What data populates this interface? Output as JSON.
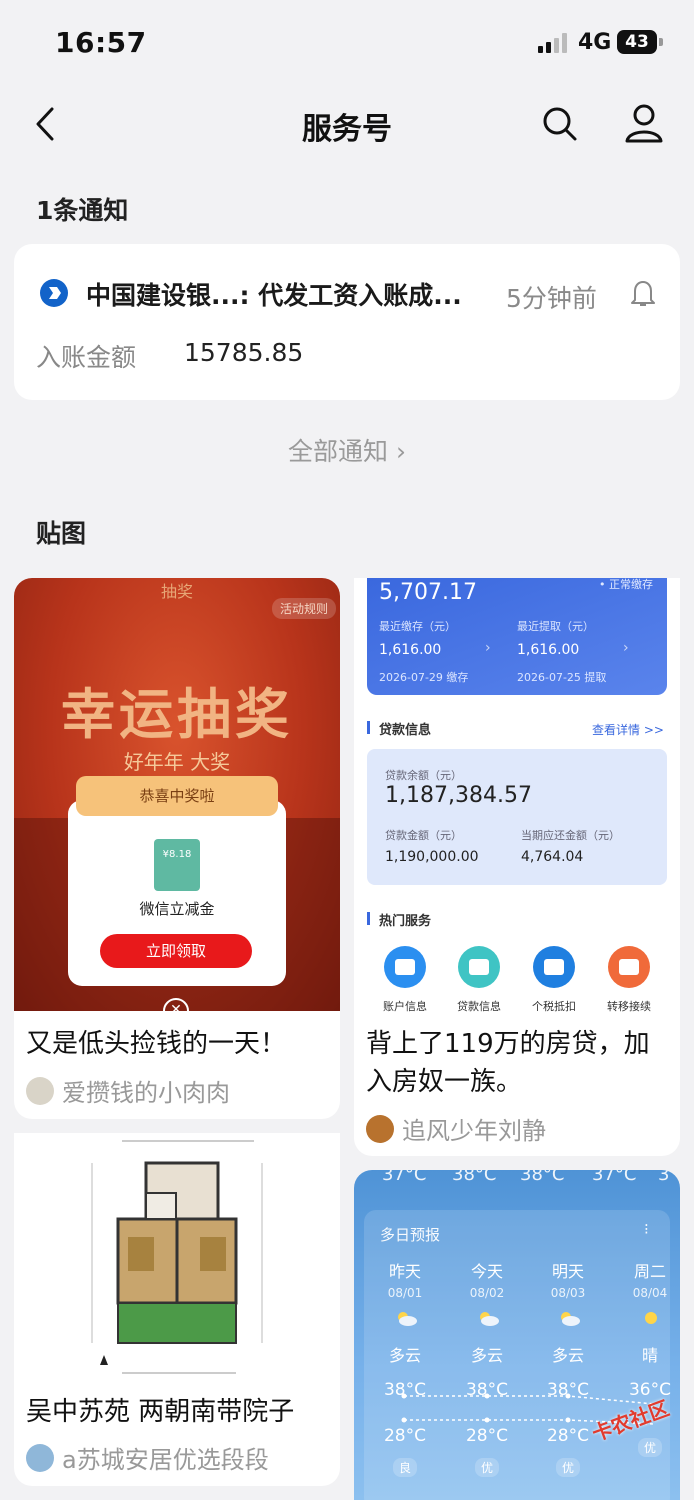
{
  "status_bar": {
    "time": "16:57",
    "network": "4G",
    "battery": "43"
  },
  "nav": {
    "title": "服务号"
  },
  "notices": {
    "heading": "1条通知",
    "item": {
      "sender": "中国建设银...: 代发工资入账成...",
      "time": "5分钟前",
      "amount_label": "入账金额",
      "amount_value": "15785.85"
    },
    "all_link": "全部通知"
  },
  "posts": {
    "heading": "贴图",
    "items": [
      {
        "caption": "又是低头捡钱的一天！",
        "author": "爱攒钱的小肉肉",
        "image": {
          "header": "抽奖",
          "rule": "活动规则",
          "title": "幸运抽奖",
          "subtitle": "好年年    大奖",
          "ribbon": "恭喜中奖啦",
          "ticket": "¥8.18",
          "prize": "微信立减金",
          "button": "立即领取"
        }
      },
      {
        "caption": "背上了119万的房贷，加入房奴一族。",
        "author": "追风少年刘静",
        "image": {
          "balance": "5,707.17",
          "status": "• 正常缴存",
          "recent_deposit_label": "最近缴存（元）",
          "recent_deposit": "1,616.00",
          "deposit_date": "2026-07-29 缴存",
          "recent_withdraw_label": "最近提取（元）",
          "recent_withdraw": "1,616.00",
          "withdraw_date": "2026-07-25 提取",
          "loan_section": "贷款信息",
          "detail_link": "查看详情 >>",
          "loan_balance_label": "贷款余额（元）",
          "loan_balance": "1,187,384.57",
          "loan_amount_label": "贷款金额（元）",
          "loan_amount": "1,190,000.00",
          "due_label": "当期应还金额（元）",
          "due_amount": "4,764.04",
          "services_section": "热门服务",
          "services": [
            "账户信息",
            "贷款信息",
            "个税抵扣",
            "转移接续"
          ],
          "service_colors": [
            "#2b8ff0",
            "#3fc4c4",
            "#1f7fe0",
            "#f06a3a"
          ]
        }
      },
      {
        "caption": "吴中苏苑 两朝南带院子",
        "author": "a苏城安居优选段段"
      },
      {
        "image": {
          "top_temps": [
            "37°C",
            "38°C",
            "38°C",
            "37°C",
            "3"
          ],
          "title": "多日预报",
          "days": [
            {
              "day": "昨天",
              "date": "08/01",
              "cond": "多云",
              "hi": "38°C",
              "lo": "28°C",
              "aqi": "良"
            },
            {
              "day": "今天",
              "date": "08/02",
              "cond": "多云",
              "hi": "38°C",
              "lo": "28°C",
              "aqi": "优"
            },
            {
              "day": "明天",
              "date": "08/03",
              "cond": "多云",
              "hi": "38°C",
              "lo": "28°C",
              "aqi": "优"
            },
            {
              "day": "周二",
              "date": "08/04",
              "cond": "晴",
              "hi": "36°C",
              "lo": "",
              "aqi": "优"
            }
          ]
        }
      }
    ]
  },
  "watermark": "卡农社区"
}
